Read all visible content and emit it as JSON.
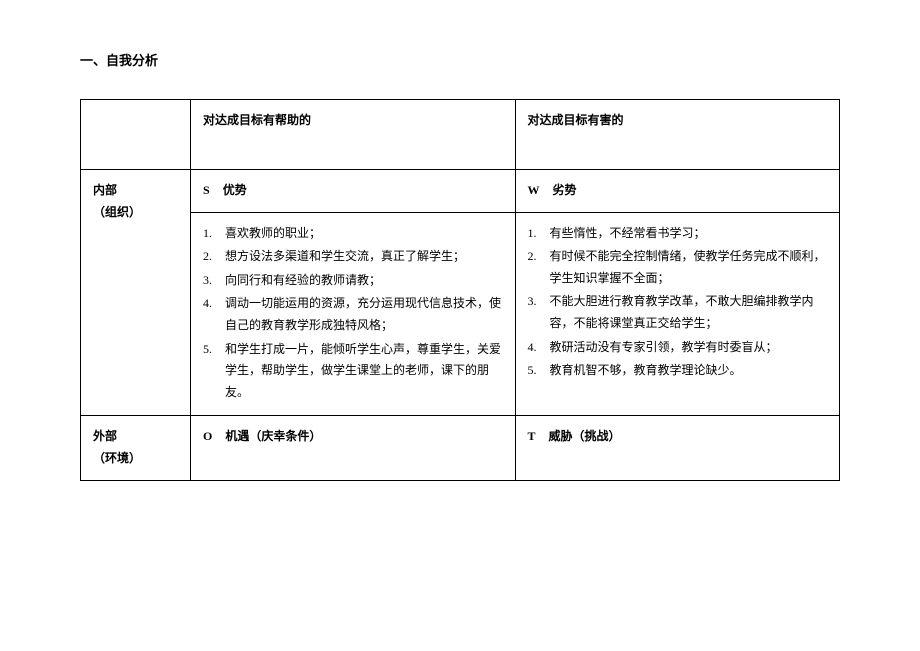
{
  "title": "一、自我分析",
  "header": {
    "helpful": "对达成目标有帮助的",
    "harmful": "对达成目标有害的"
  },
  "internal": {
    "label_main": "内部",
    "label_sub": "（组织）",
    "strength": {
      "letter": "S",
      "name": "优势",
      "items": [
        "喜欢教师的职业；",
        "想方设法多渠道和学生交流，真正了解学生；",
        "向同行和有经验的教师请教；",
        "调动一切能运用的资源，充分运用现代信息技术，使自己的教育教学形成独特风格；",
        "和学生打成一片，能倾听学生心声，尊重学生，关爱学生，帮助学生，做学生课堂上的老师，课下的朋友。"
      ]
    },
    "weakness": {
      "letter": "W",
      "name": "劣势",
      "items": [
        "有些惰性，不经常看书学习；",
        "有时候不能完全控制情绪，使教学任务完成不顺利，学生知识掌握不全面；",
        "不能大胆进行教育教学改革，不敢大胆编排教学内容，不能将课堂真正交给学生；",
        "教研活动没有专家引领，教学有时委盲从；",
        "教育机智不够，教育教学理论缺少。"
      ]
    }
  },
  "external": {
    "label_main": "外部",
    "label_sub": "（环境）",
    "opportunity": {
      "letter": "O",
      "name": "机遇（庆幸条件）"
    },
    "threat": {
      "letter": "T",
      "name": "威胁（挑战）"
    }
  }
}
